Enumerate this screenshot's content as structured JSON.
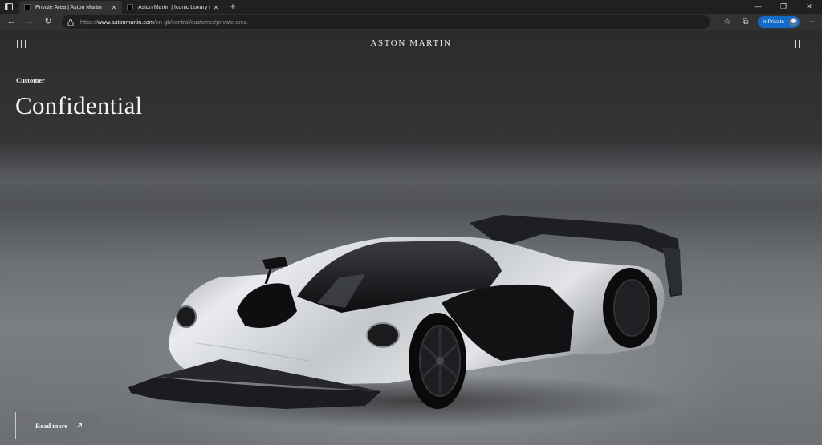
{
  "browser": {
    "tabs": [
      {
        "title": "Private Area | Aston Martin",
        "active": true
      },
      {
        "title": "Aston Martin | Iconic Luxury Briti",
        "active": false
      }
    ],
    "url": {
      "protocol": "https://",
      "host": "www.astonmartin.com",
      "path": "/en-gb/control/customer/private-area"
    },
    "inprivate_label": "InPrivate",
    "icons": {
      "back": "back-arrow-icon",
      "forward": "forward-arrow-icon",
      "refresh": "refresh-icon",
      "favorites": "favorites-star-icon",
      "collections": "collections-icon",
      "more": "more-dots-icon"
    }
  },
  "page": {
    "brand": "ASTON MARTIN",
    "eyebrow": "Customer",
    "headline": "Confidential",
    "cta_label": "Read more"
  },
  "colors": {
    "accent_inprivate": "#1469c9",
    "chrome_dark": "#202020",
    "chrome_toolbar": "#323232",
    "text_light": "#f2f2f2"
  }
}
